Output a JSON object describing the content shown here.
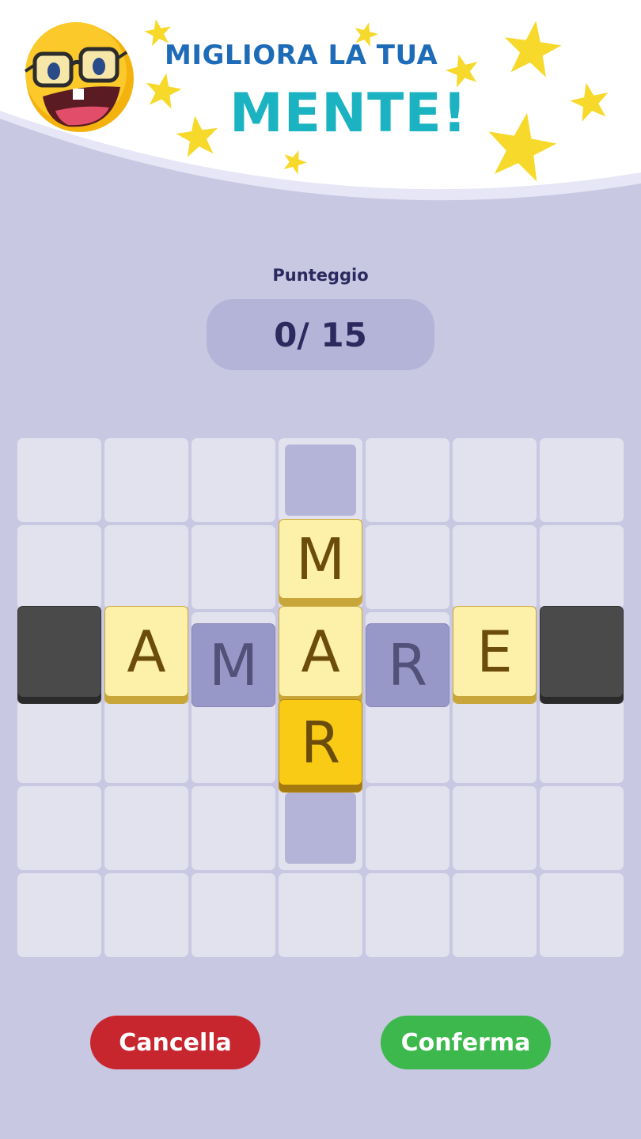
{
  "banner": {
    "line1": "MIGLIORA LA TUA",
    "line2": "MENTE!",
    "emoji_icon": "nerd-smiley-icon",
    "star_icon": "star-icon"
  },
  "score": {
    "label": "Punteggio",
    "value": "0/ 15"
  },
  "board": {
    "rows": 6,
    "cols": 7,
    "tiles": [
      {
        "row": 1,
        "col": 3,
        "letter": "M",
        "style": "cream"
      },
      {
        "row": 2,
        "col": 0,
        "letter": "",
        "style": "dark"
      },
      {
        "row": 2,
        "col": 1,
        "letter": "A",
        "style": "cream"
      },
      {
        "row": 2,
        "col": 2,
        "letter": "M",
        "style": "purple"
      },
      {
        "row": 2,
        "col": 3,
        "letter": "A",
        "style": "cream"
      },
      {
        "row": 2,
        "col": 4,
        "letter": "R",
        "style": "purple"
      },
      {
        "row": 2,
        "col": 5,
        "letter": "E",
        "style": "cream"
      },
      {
        "row": 2,
        "col": 6,
        "letter": "",
        "style": "dark"
      },
      {
        "row": 3,
        "col": 3,
        "letter": "R",
        "style": "gold"
      }
    ],
    "empty_slots": [
      {
        "row": 0,
        "col": 3
      },
      {
        "row": 4,
        "col": 3
      }
    ]
  },
  "buttons": {
    "cancel": "Cancella",
    "confirm": "Conferma"
  },
  "colors": {
    "background": "#c8c8e2",
    "headline_blue": "#1e6bb8",
    "headline_teal": "#1bb3c2",
    "cancel": "#c8262e",
    "confirm": "#3cb84c"
  }
}
